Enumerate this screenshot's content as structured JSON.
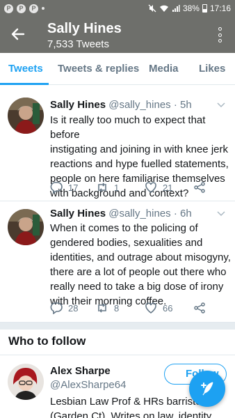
{
  "status_bar": {
    "notification_icons": [
      "pinterest-icon",
      "pinterest-icon",
      "pinterest-icon"
    ],
    "battery": "38%",
    "time": "17:16"
  },
  "header": {
    "name": "Sally Hines",
    "tweet_count": "7,533 Tweets"
  },
  "tabs": [
    {
      "label": "Tweets",
      "active": true
    },
    {
      "label": "Tweets & replies",
      "active": false
    },
    {
      "label": "Media",
      "active": false
    },
    {
      "label": "Likes",
      "active": false
    }
  ],
  "tweets": [
    {
      "name": "Sally Hines",
      "handle": "@sally_hines",
      "time": "· 5h",
      "lines": [
        "Is it really too much to expect that before",
        "instigating and joining in with knee jerk",
        "reactions and hype fuelled statements,",
        "people on here familiarise themselves",
        "with background and context?"
      ],
      "replies": "17",
      "retweets": "1",
      "likes": "21"
    },
    {
      "name": "Sally Hines",
      "handle": "@sally_hines",
      "time": "· 6h",
      "lines": [
        "When it comes to the policing of",
        "gendered bodies, sexualities and",
        "identities, and outrage about misogyny,",
        "there are a lot of people out there who",
        "really need to take a big dose of irony",
        "with their morning coffee."
      ],
      "replies": "28",
      "retweets": "8",
      "likes": "66"
    }
  ],
  "who_to_follow": {
    "title": "Who to follow",
    "user": {
      "name": "Alex Sharpe",
      "handle": "@AlexSharpe64",
      "bio_lines": [
        "Lesbian Law Prof & HRs barrister",
        "(Garden Ct). Writes on law, identity, desi..."
      ],
      "follow_label": "Follow"
    }
  },
  "colors": {
    "accent": "#1da1f2",
    "header_bg": "#6e6f6b",
    "muted": "#657786"
  }
}
